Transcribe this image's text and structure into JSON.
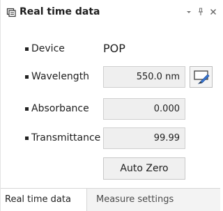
{
  "panel": {
    "title": "Real time data",
    "title_icon": "panel-icon"
  },
  "titlebar_buttons": {
    "dropdown_icon": "chevron-down-icon",
    "pin_icon": "pin-icon",
    "close_icon": "close-icon"
  },
  "rows": {
    "device": {
      "label": "Device",
      "value": "POP"
    },
    "wavelength": {
      "label": "Wavelength",
      "value": "550.0 nm"
    },
    "absorbance": {
      "label": "Absorbance",
      "value": "0.000"
    },
    "transmittance": {
      "label": "Transmittance",
      "value": "99.99"
    }
  },
  "buttons": {
    "auto_zero": "Auto Zero",
    "edit_icon": "edit-pencil-icon"
  },
  "tabs": [
    {
      "label": "Real time data",
      "active": true
    },
    {
      "label": "Measure settings",
      "active": false
    }
  ],
  "colors": {
    "edit_accent": "#3a78d6",
    "value_box_bg": "#efefef"
  }
}
